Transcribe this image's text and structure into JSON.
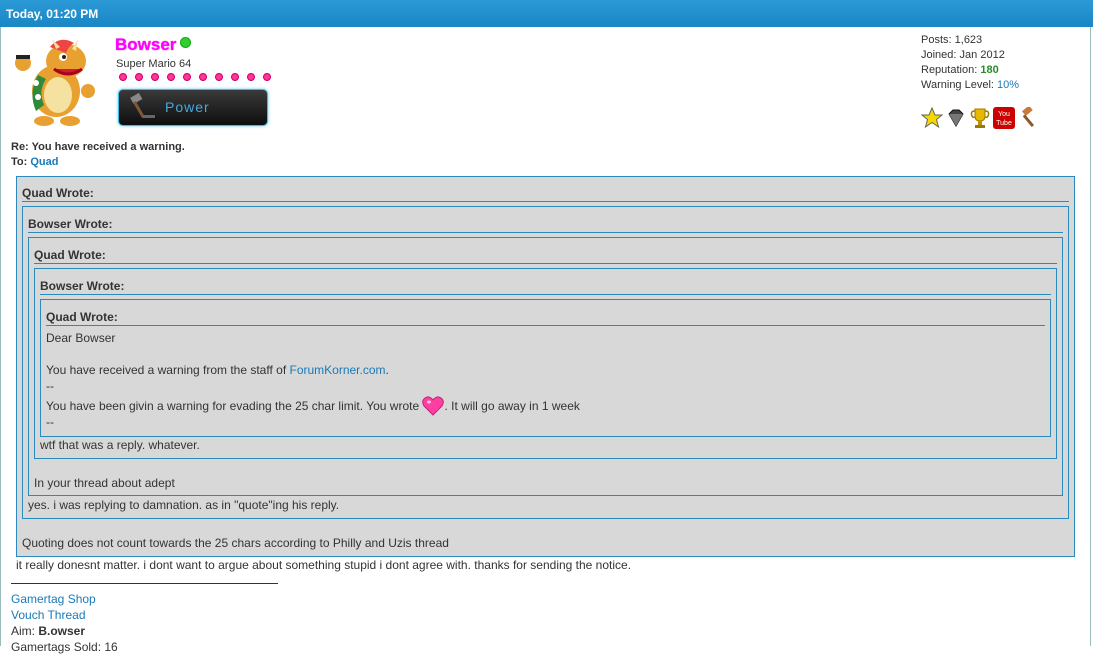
{
  "post": {
    "date": "Today, 01:20 PM",
    "author": {
      "name": "Bowser",
      "title": "Super Mario 64",
      "button_label": "Power",
      "stats": {
        "posts_label": "Posts:",
        "posts": "1,623",
        "joined_label": "Joined:",
        "joined": "Jan 2012",
        "reputation_label": "Reputation:",
        "reputation": "180",
        "warning_label": "Warning Level:",
        "warning": "10%"
      },
      "badges": [
        "star-icon",
        "diamond-icon",
        "trophy-icon",
        "youtube-icon",
        "gavel-icon"
      ],
      "youtube_text_top": "You",
      "youtube_text_bottom": "Tube"
    },
    "subject_line": "Re: You have received a warning.",
    "to_label": "To:",
    "to_user": "Quad",
    "quotes": {
      "q1_header": "Quad Wrote:",
      "q2_header": "Bowser Wrote:",
      "q3_header": "Quad Wrote:",
      "q4_header": "Bowser Wrote:",
      "q5_header": "Quad Wrote:",
      "q5_line1": "Dear Bowser",
      "q5_line2_pre": "You have received a warning from the staff of ",
      "q5_line2_link": "ForumKorner.com",
      "q5_line2_post": ".",
      "q5_sep1": "--",
      "q5_line3_pre": "You have been givin a warning for evading the 25 char limit. You wrote",
      "q5_line3_post": ". It will go away in 1 week",
      "q5_sep2": "--",
      "q4_reply": "wtf that was a reply. whatever.",
      "q3_reply": "In your thread about adept",
      "q2_reply": "yes. i was replying to damnation. as in \"quote\"ing his reply.",
      "q1_reply": "Quoting does not count towards the 25 chars according to Philly and Uzis thread"
    },
    "body_text": "it really donesnt matter. i dont want to argue about something stupid i dont agree with. thanks for sending the notice.",
    "signature": {
      "link1": "Gamertag Shop",
      "link2": "Vouch Thread",
      "aim_label": "Aim:",
      "aim_value": "B.owser",
      "partial_line": "Gamertags Sold: 16"
    }
  },
  "colors": {
    "header_bg": "#1a86c4",
    "quote_border": "#2a8abf",
    "quote_bg": "#d8d8d8",
    "link": "#1a7ab8",
    "username": "#ff00ff",
    "reputation": "#2a8a2a"
  }
}
